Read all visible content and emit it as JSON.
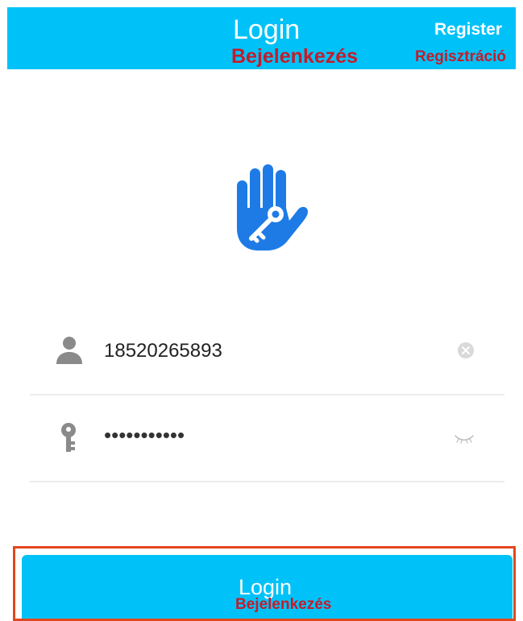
{
  "header": {
    "title": "Login",
    "title_translation": "Bejelenkezés",
    "register_label": "Register",
    "register_translation": "Regisztráció"
  },
  "logo": {
    "icon": "hand-key-icon",
    "color": "#1E7BE6"
  },
  "form": {
    "username": {
      "icon": "user-icon",
      "value": "18520265893",
      "action_icon": "clear-icon"
    },
    "password": {
      "icon": "key-icon",
      "value": "•••••••••••",
      "action_icon": "eye-closed-icon"
    }
  },
  "login_button": {
    "label": "Login",
    "translation": "Bejelenkezés"
  },
  "colors": {
    "primary": "#00C2F8",
    "translation_text": "#C41C2A",
    "highlight_frame": "#E1481F",
    "brand_blue": "#1E7BE6"
  }
}
